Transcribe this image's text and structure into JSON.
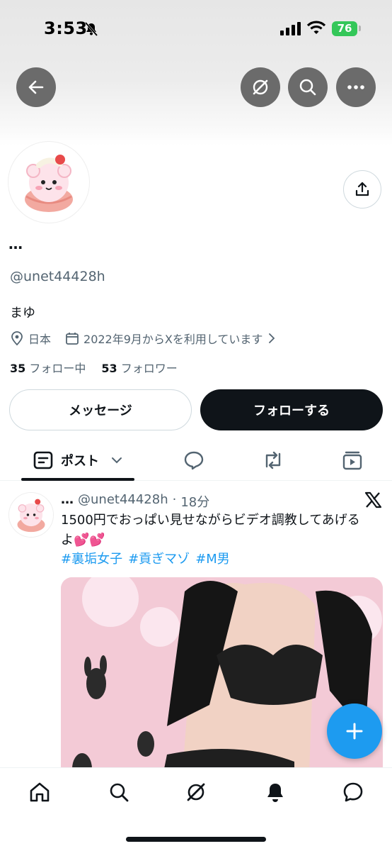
{
  "status_bar": {
    "time": "3:53",
    "battery": "76"
  },
  "profile": {
    "display_name": "…",
    "handle": "@unet44428h",
    "bio": "まゆ",
    "location": "日本",
    "joined": "2022年9月からXを利用しています",
    "following_count": "35",
    "following_label": "フォロー中",
    "followers_count": "53",
    "followers_label": "フォロワー"
  },
  "actions": {
    "message_label": "メッセージ",
    "follow_label": "フォローする"
  },
  "tabs": {
    "posts_label": "ポスト"
  },
  "post": {
    "name": "…",
    "handle": "@unet44428h",
    "separator": "·",
    "time": "18分",
    "text": "1500円でおっぱい見せながらビデオ調教してあげるよ💕💕",
    "hashtags": [
      "#裏垢女子",
      "#貢ぎマゾ",
      "#M男"
    ]
  },
  "icons": {
    "back": "arrow-left-icon",
    "grok": "grok-icon",
    "search": "search-icon",
    "more": "more-horizontal-icon",
    "share": "share-icon",
    "location": "location-pin-icon",
    "calendar": "calendar-icon",
    "chevron": "chevron-right-icon",
    "posts_tab": "posts-list-icon",
    "replies_tab": "reply-bubble-icon",
    "reposts_tab": "repost-icon",
    "media_tab": "media-icon",
    "x_logo": "x-logo-icon",
    "compose": "plus-icon",
    "nav_home": "home-icon",
    "nav_search": "search-icon",
    "nav_grok": "grok-icon",
    "nav_notifications": "bell-icon",
    "nav_messages": "message-icon"
  },
  "colors": {
    "accent": "#1d9bf0",
    "battery": "#34c759",
    "text": "#0f1419",
    "muted": "#536471"
  }
}
